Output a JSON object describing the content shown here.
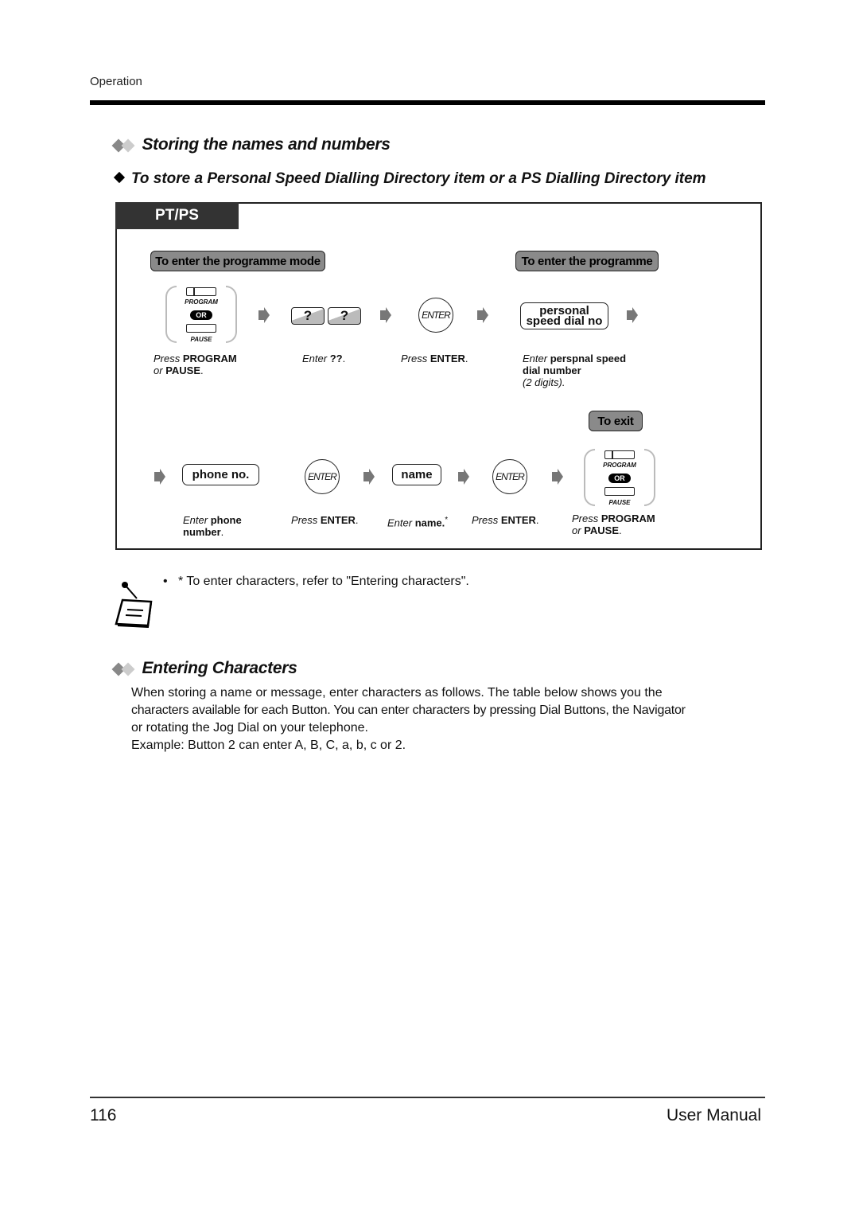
{
  "header": {
    "section_label": "Operation"
  },
  "section1": {
    "title": "Storing the names and numbers",
    "subtitle": "To store a Personal Speed Dialling Directory item or a PS Dialling Directory item",
    "tag": "PT/PS",
    "pills": {
      "enter_mode": "To enter the programme mode",
      "enter_programme": "To enter the programme",
      "exit": "To exit"
    },
    "keys": {
      "program": "PROGRAM",
      "pause": "PAUSE",
      "or": "OR",
      "question": "?",
      "enter": "ENTER",
      "personal_line1": "personal",
      "personal_line2": "speed dial no",
      "phone_no": "phone no.",
      "name": "name"
    },
    "steps_row1": [
      {
        "verb": "Press",
        "bold": "PROGRAM",
        "line2_verb": "or",
        "line2_bold": "PAUSE",
        "tail": "."
      },
      {
        "verb": "Enter",
        "bold": "??",
        "tail": "."
      },
      {
        "verb": "Press",
        "bold": "ENTER",
        "tail": "."
      },
      {
        "verb": "Enter",
        "bold": "perspnal speed",
        "line2_bold": "dial number",
        "line3": "(2 digits)."
      }
    ],
    "steps_row2": [
      {
        "verb": "Enter",
        "bold": "phone",
        "line2_bold": "number",
        "tail": "."
      },
      {
        "verb": "Press",
        "bold": "ENTER",
        "tail": "."
      },
      {
        "verb": "Enter",
        "bold": "name.",
        "tail": "*"
      },
      {
        "verb": "Press",
        "bold": "ENTER",
        "tail": "."
      },
      {
        "verb": "Press",
        "bold": "PROGRAM",
        "line2_verb": "or",
        "line2_bold": "PAUSE",
        "tail": "."
      }
    ]
  },
  "note": {
    "bullet": "•",
    "text": "* To enter characters, refer to \"Entering characters\"."
  },
  "section2": {
    "title": "Entering Characters",
    "paragraph_lines": [
      "When storing a name or message, enter characters as follows. The table below shows you the",
      "characters available for each Button. You can enter characters by pressing Dial Buttons, the Navigator",
      "or rotating the Jog Dial on your telephone.",
      "Example: Button 2 can enter A, B, C, a, b, c or 2."
    ]
  },
  "footer": {
    "page_number": "116",
    "manual_label": "User Manual"
  }
}
